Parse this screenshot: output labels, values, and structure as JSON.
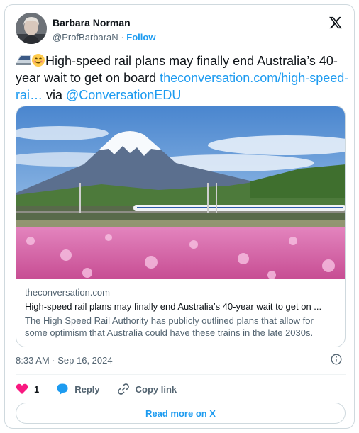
{
  "author": {
    "name": "Barbara Norman",
    "handle": "@ProfBarbaraN",
    "separator": "·",
    "follow_label": "Follow"
  },
  "tweet": {
    "emojis": [
      "high-speed-train",
      "smiling-face"
    ],
    "text": "High-speed rail plans may finally end Australia’s 40-year wait to get on board ",
    "link_text": "theconversation.com/high-speed-rai…",
    "via_text": " via ",
    "mention": "@ConversationEDU"
  },
  "link_card": {
    "domain": "theconversation.com",
    "title": "High-speed rail plans may finally end Australia’s 40-year wait to get on ...",
    "description": "The High Speed Rail Authority has publicly outlined plans that allow for some optimism that Australia could have these trains in the late 2030s.",
    "image_subject": "Shinkansen train passing snow-capped Mount Fuji above a field of pink flowers"
  },
  "meta": {
    "timestamp": "8:33 AM · Sep 16, 2024"
  },
  "actions": {
    "like_count": "1",
    "reply_label": "Reply",
    "copy_label": "Copy link"
  },
  "footer": {
    "read_more_label": "Read more on X"
  },
  "colors": {
    "accent": "#1d9bf0",
    "like": "#f91880",
    "text": "#0f1419",
    "secondary": "#536471",
    "border": "#cfd9de"
  }
}
